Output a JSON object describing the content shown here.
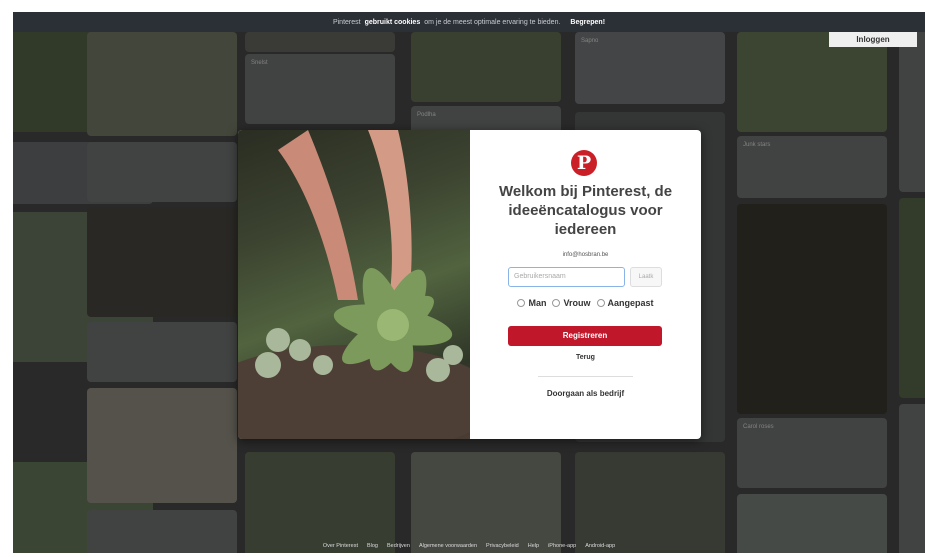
{
  "cookie_bar": {
    "prefix": "Pinterest",
    "bold": "gebruikt cookies",
    "suffix": "om je de meest optimale ervaring te bieden.",
    "accept": "Begrepen!"
  },
  "header": {
    "login_label": "Inloggen"
  },
  "background_pins": [
    {
      "title": "Snelst",
      "note": "Pinned from"
    },
    {
      "title": "Podlha",
      "note": "Pinned from"
    },
    {
      "title": "Sapno",
      "note": "Pinned from"
    },
    {
      "title": "Junk stars",
      "note": "Pinned to plume"
    },
    {
      "title": "Carol roses",
      "note": "Pinned from"
    }
  ],
  "modal": {
    "logo_glyph": "P",
    "headline": "Welkom bij Pinterest, de ideeëncatalogus voor iedereen",
    "email": "info@hosbran.be",
    "password_placeholder": "Gebruikersnaam",
    "next_label": "Laatk",
    "genders": [
      "Man",
      "Vrouw",
      "Aangepast"
    ],
    "register_label": "Registreren",
    "back_label": "Terug",
    "business_label": "Doorgaan als bedrijf"
  },
  "footer_links": [
    "Over Pinterest",
    "Blog",
    "Bedrijven",
    "Algemene voorwaarden",
    "Privacybeleid",
    "Help",
    "iPhone-app",
    "Android-app"
  ],
  "colors": {
    "brand": "#cb1f27",
    "register": "#c0172a",
    "cookie_bar": "#2b2f36"
  }
}
